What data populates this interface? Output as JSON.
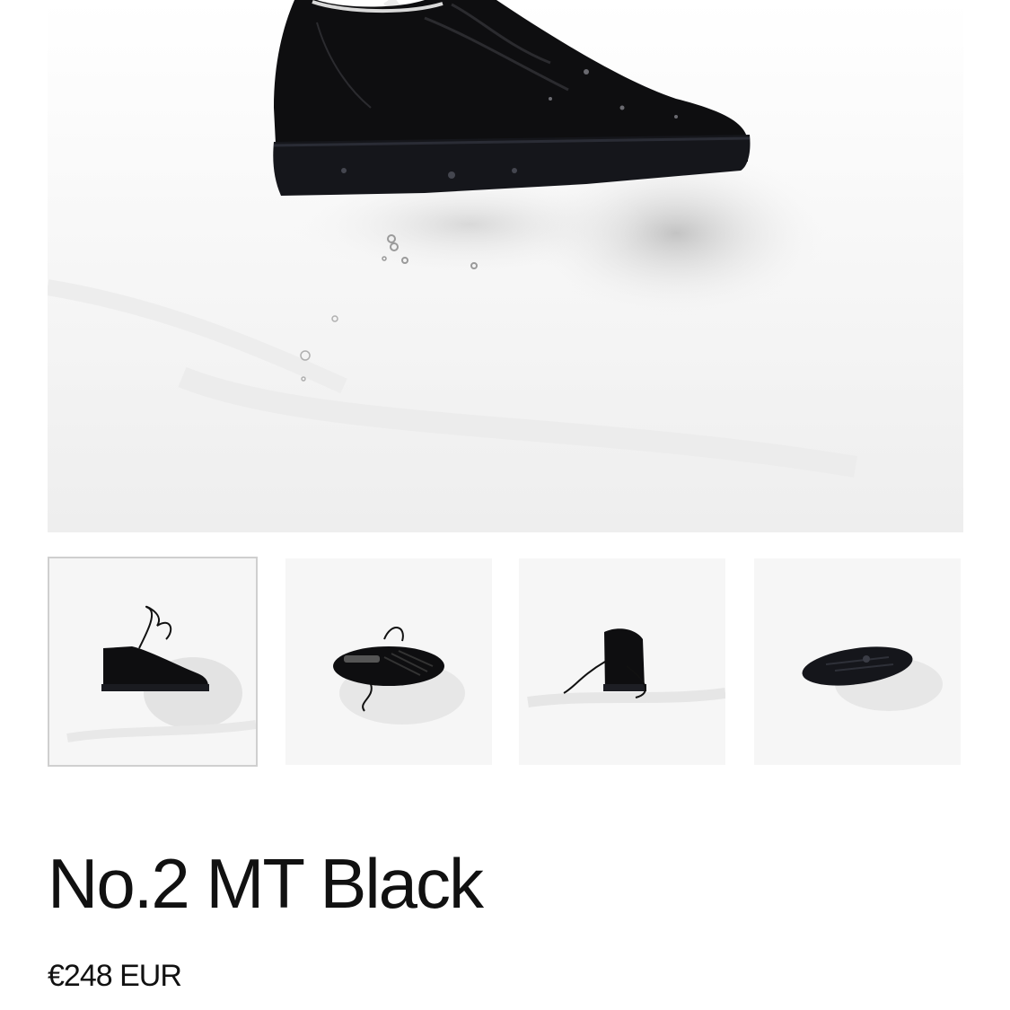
{
  "product": {
    "title": "No.2 MT Black",
    "price": "€248 EUR"
  },
  "gallery": {
    "main_image": "black-sneaker-side-view-splash",
    "thumbnails": [
      {
        "icon": "sneaker-side-view",
        "selected": true
      },
      {
        "icon": "sneaker-top-view",
        "selected": false
      },
      {
        "icon": "sneaker-back-view",
        "selected": false
      },
      {
        "icon": "sneaker-sole-view",
        "selected": false
      }
    ]
  },
  "colors": {
    "background": "#ffffff",
    "image_background": "#f6f6f6",
    "shoe": "#0e0e10",
    "text": "#111111",
    "selected_border": "#cfcfcf"
  }
}
